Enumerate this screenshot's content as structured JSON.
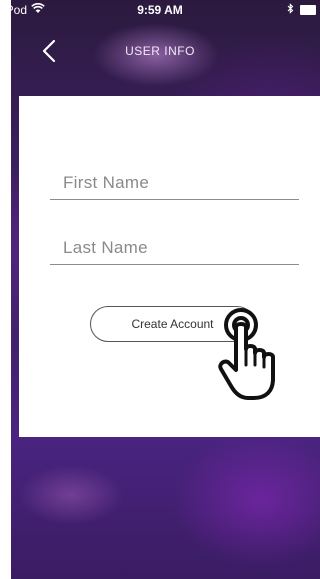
{
  "status_bar": {
    "carrier": "iPod",
    "time": "9:59 AM",
    "wifi_icon": "wifi-icon",
    "bluetooth_icon": "bluetooth-icon",
    "battery_icon": "battery-icon"
  },
  "nav": {
    "title": "USER INFO",
    "back_icon": "chevron-left-icon"
  },
  "form": {
    "first_name": {
      "value": "",
      "placeholder": "First Name"
    },
    "last_name": {
      "value": "",
      "placeholder": "Last Name"
    },
    "create_account_label": "Create Account"
  },
  "overlay": {
    "pointer_icon": "tap-hand-icon"
  },
  "colors": {
    "background_purple": "#3d2163",
    "card": "#ffffff",
    "divider": "#8c8c8c",
    "text_placeholder": "#8a8a8a"
  }
}
